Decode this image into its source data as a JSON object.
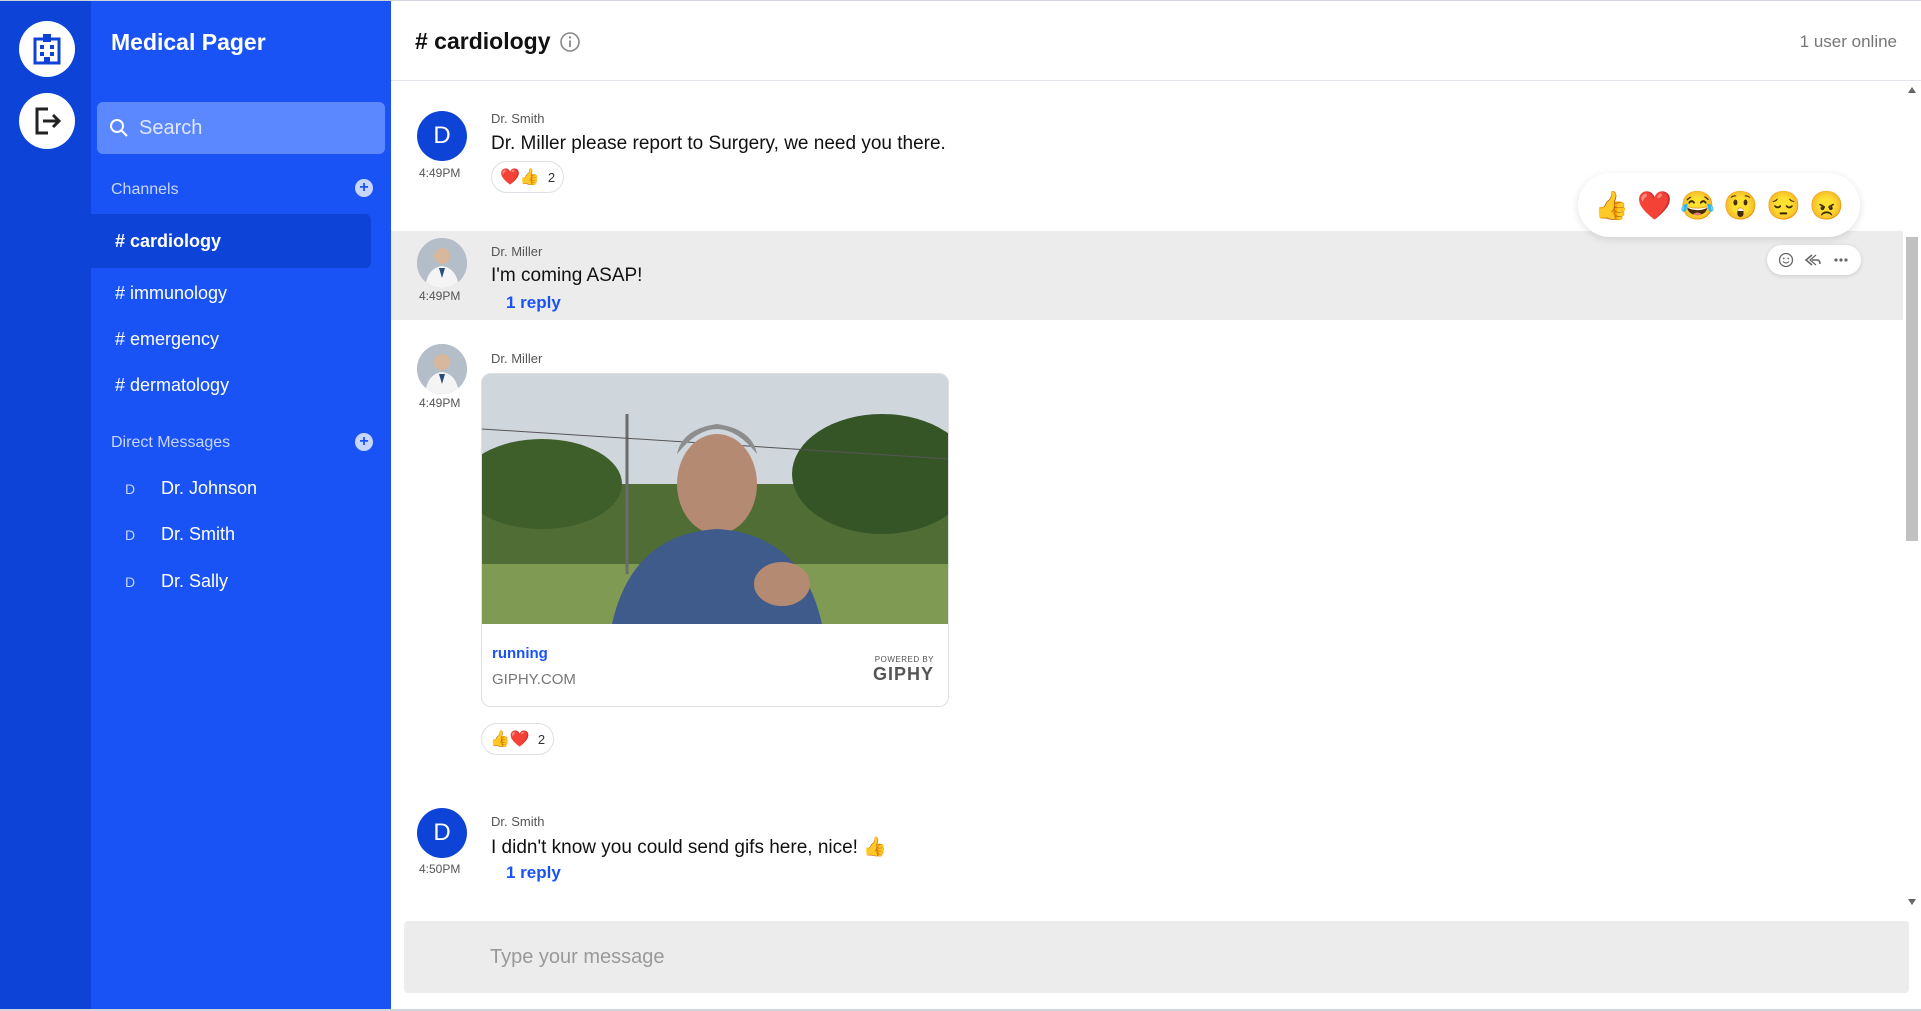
{
  "app": {
    "title": "Medical Pager"
  },
  "search": {
    "placeholder": "Search"
  },
  "sidebar": {
    "channels_label": "Channels",
    "channels": [
      {
        "label": "# cardiology",
        "active": true
      },
      {
        "label": "# immunology"
      },
      {
        "label": "# emergency"
      },
      {
        "label": "# dermatology"
      }
    ],
    "dms_label": "Direct Messages",
    "dms": [
      {
        "initial": "D",
        "name": "Dr. Johnson"
      },
      {
        "initial": "D",
        "name": "Dr. Smith"
      },
      {
        "initial": "D",
        "name": "Dr. Sally"
      }
    ]
  },
  "header": {
    "channel": "# cardiology",
    "online": "1 user online"
  },
  "messages": [
    {
      "author": "Dr. Smith",
      "avatar_initial": "D",
      "time": "4:49PM",
      "text": "Dr. Miller please report to Surgery, we need you there.",
      "reactions": {
        "emojis": "❤️👍",
        "count": "2"
      }
    },
    {
      "author": "Dr. Miller",
      "time": "4:49PM",
      "text": "I'm coming ASAP!",
      "reply": "1 reply"
    },
    {
      "author": "Dr. Miller",
      "time": "4:49PM",
      "gif": {
        "title": "running",
        "domain": "GIPHY.COM",
        "powered": "POWERED BY",
        "brand": "GIPHY"
      },
      "reactions": {
        "emojis": "👍❤️",
        "count": "2"
      }
    },
    {
      "author": "Dr. Smith",
      "avatar_initial": "D",
      "time": "4:50PM",
      "text": "I didn't know you could send gifs here, nice! 👍",
      "reply": "1 reply"
    }
  ],
  "emoji_picker": [
    "👍",
    "❤️",
    "😂",
    "😲",
    "😔",
    "😠"
  ],
  "composer": {
    "placeholder": "Type your message"
  },
  "colors": {
    "rail": "#0d43d6",
    "sidebar": "#1a53f5",
    "accent": "#1a53f5",
    "hover_row": "#ececec"
  }
}
